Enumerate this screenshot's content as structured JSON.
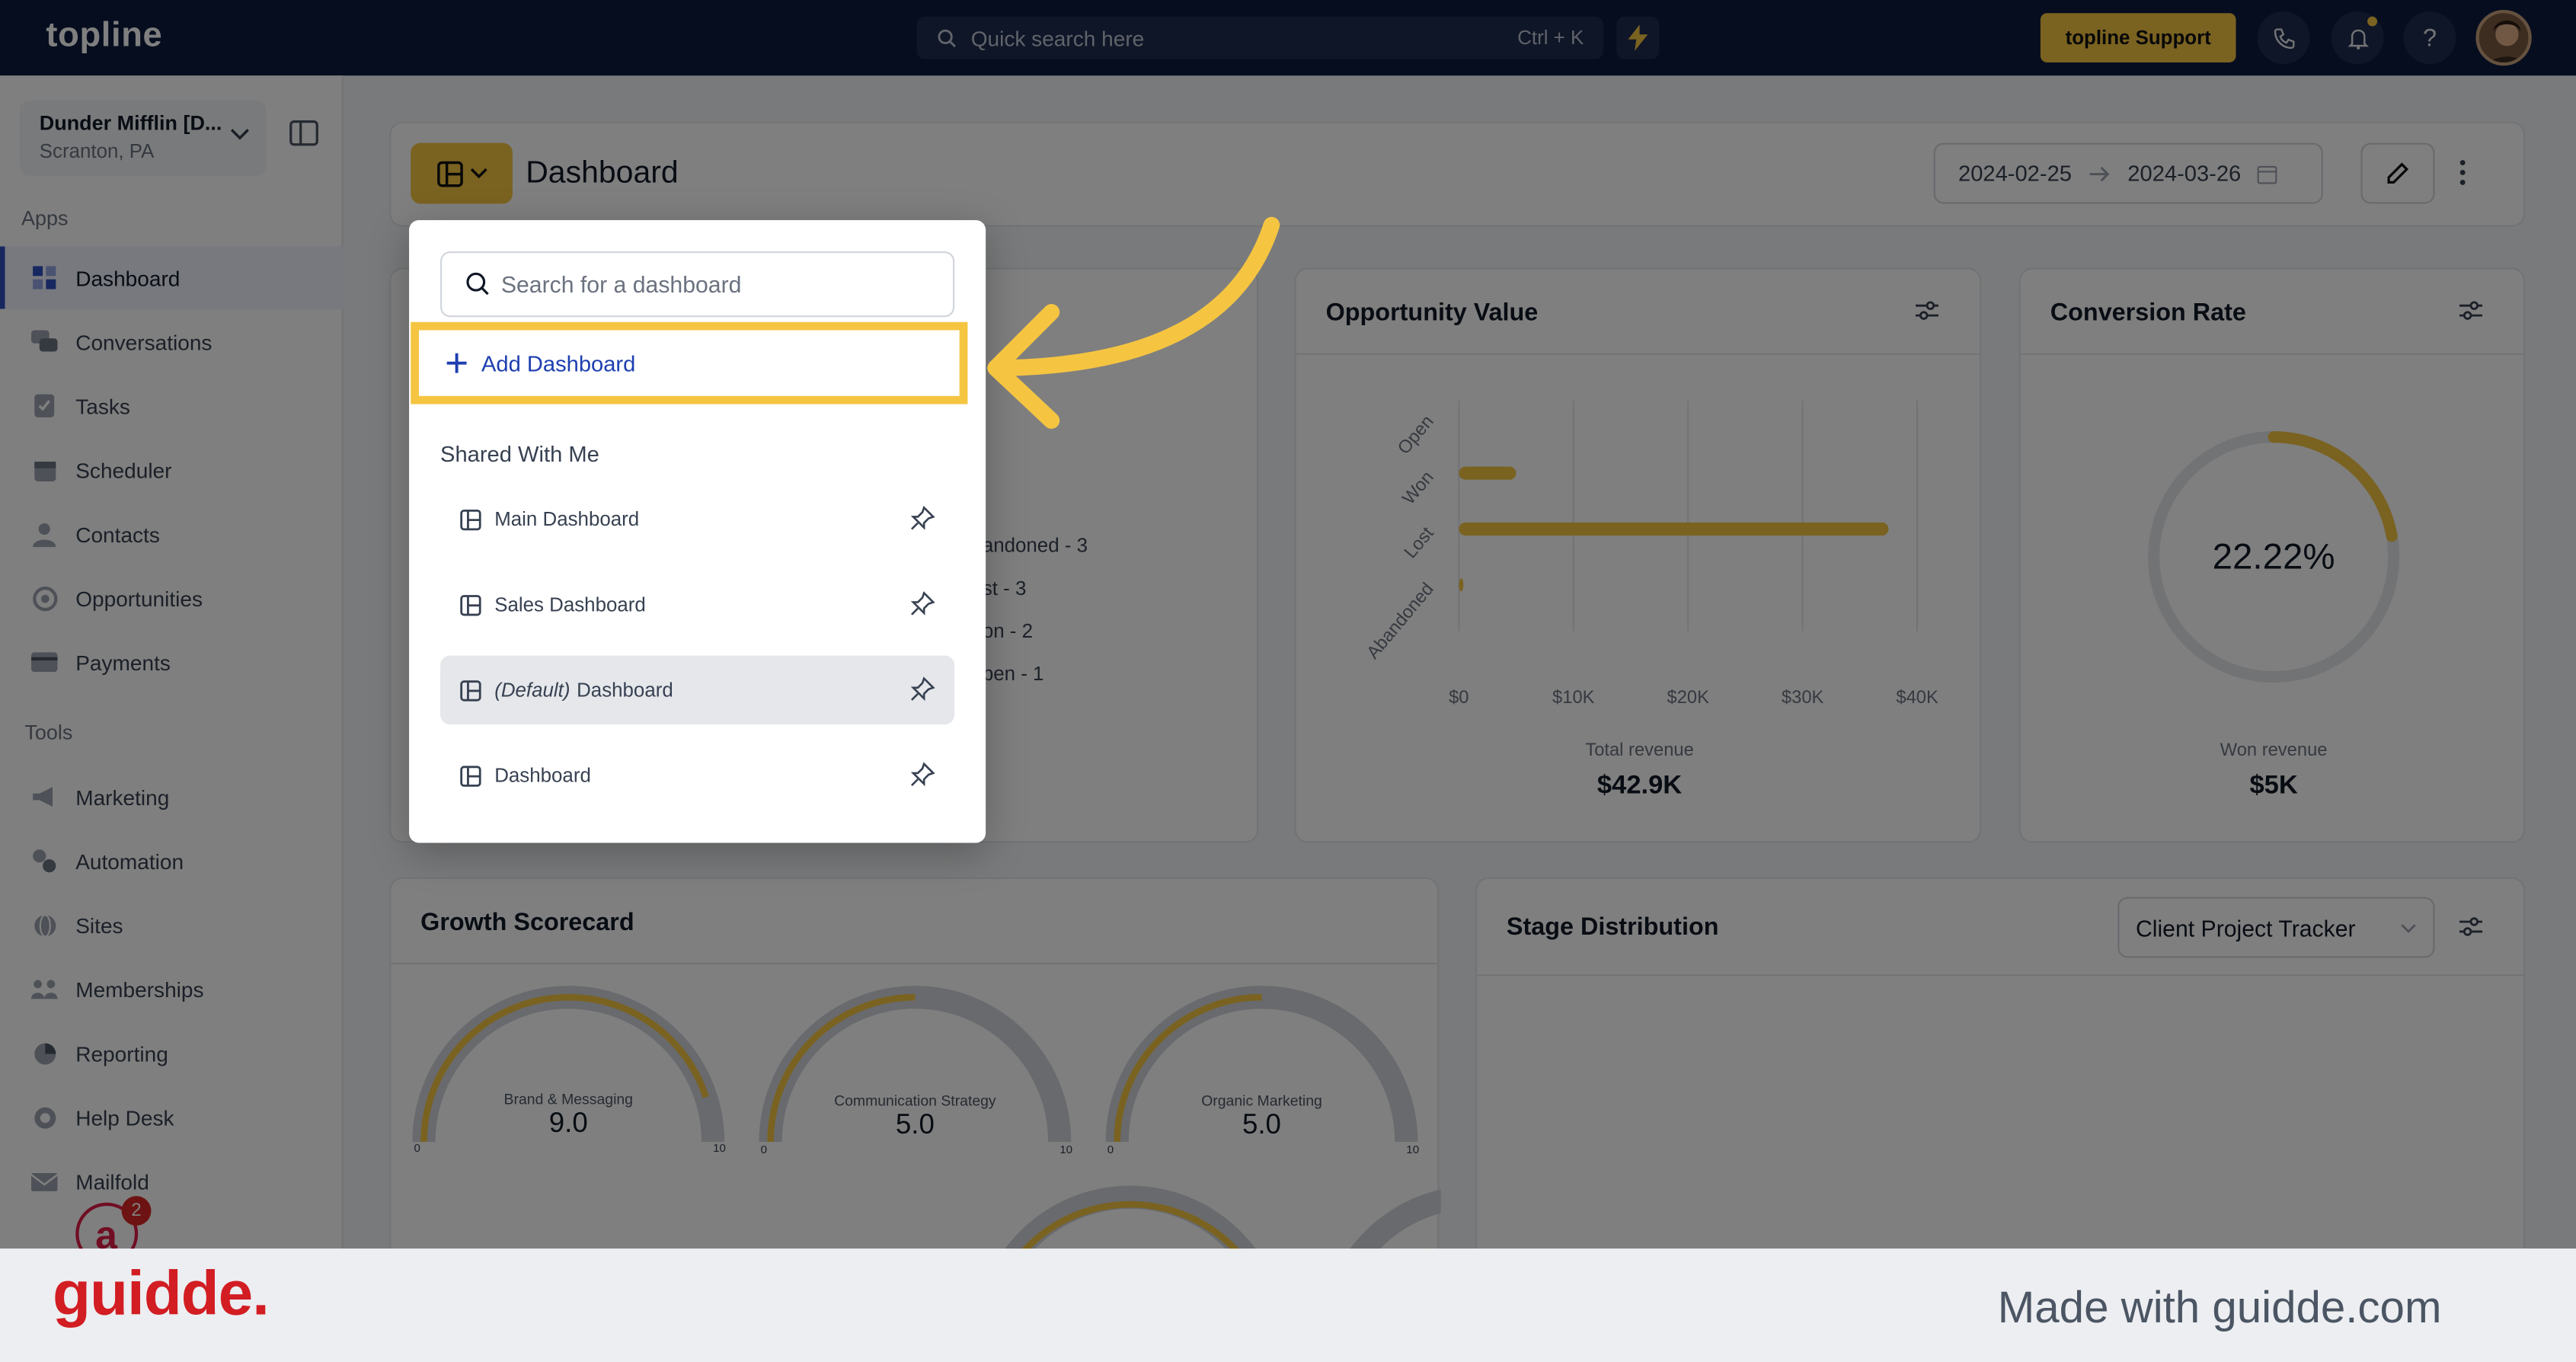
{
  "app": {
    "logo": "topline"
  },
  "topbar": {
    "search_placeholder": "Quick search here",
    "search_shortcut": "Ctrl + K",
    "support_label": "topline Support",
    "phone_icon": "phone-icon",
    "bell_icon": "bell-icon",
    "help_icon": "help-icon",
    "help_glyph": "?"
  },
  "sidebar": {
    "location": {
      "name": "Dunder Mifflin [D...",
      "address": "Scranton, PA"
    },
    "apps_label": "Apps",
    "apps": [
      {
        "label": "Dashboard",
        "icon": "dashboard-icon",
        "active": true
      },
      {
        "label": "Conversations",
        "icon": "chat-icon"
      },
      {
        "label": "Tasks",
        "icon": "tasks-icon"
      },
      {
        "label": "Scheduler",
        "icon": "calendar-icon"
      },
      {
        "label": "Contacts",
        "icon": "contacts-icon"
      },
      {
        "label": "Opportunities",
        "icon": "opportunities-icon"
      },
      {
        "label": "Payments",
        "icon": "payments-icon"
      }
    ],
    "tools_label": "Tools",
    "tools": [
      {
        "label": "Marketing",
        "icon": "megaphone-icon"
      },
      {
        "label": "Automation",
        "icon": "automation-icon"
      },
      {
        "label": "Sites",
        "icon": "globe-icon"
      },
      {
        "label": "Memberships",
        "icon": "memberships-icon"
      },
      {
        "label": "Reporting",
        "icon": "pie-chart-icon"
      },
      {
        "label": "Help Desk",
        "icon": "help-desk-icon"
      },
      {
        "label": "Mailfold",
        "icon": "mailfold-icon"
      }
    ],
    "notification_count": "2"
  },
  "header": {
    "title": "Dashboard",
    "date_start": "2024-02-25",
    "date_end": "2024-03-26"
  },
  "opportunity_value": {
    "title": "Opportunity Value",
    "total_label": "Total revenue",
    "total_value": "$42.9K",
    "chart_data": {
      "type": "bar",
      "orientation": "horizontal",
      "categories": [
        "Open",
        "Won",
        "Lost",
        "Abandoned"
      ],
      "values": [
        0,
        5000,
        37500,
        400
      ],
      "x_ticks": [
        "$0",
        "$10K",
        "$20K",
        "$30K",
        "$40K"
      ],
      "xlim": [
        0,
        40000
      ],
      "color": "#f5c542"
    }
  },
  "conversion_rate": {
    "title": "Conversion Rate",
    "value_label": "22.22%",
    "percent": 22.22,
    "caption": "Won revenue",
    "caption_value": "$5K"
  },
  "hidden_card": {
    "legend": [
      "andoned - 3",
      "st - 3",
      "on - 2",
      "pen - 1"
    ]
  },
  "growth_scorecard": {
    "title": "Growth Scorecard",
    "gauges": [
      {
        "label": "Brand & Messaging",
        "value": "9.0",
        "fraction": 0.9,
        "min": "0",
        "max": "10"
      },
      {
        "label": "Communication Strategy",
        "value": "5.0",
        "fraction": 0.5,
        "min": "0",
        "max": "10"
      },
      {
        "label": "Organic Marketing",
        "value": "5.0",
        "fraction": 0.5,
        "min": "0",
        "max": "10"
      }
    ]
  },
  "stage_distribution": {
    "title": "Stage Distribution",
    "pipeline": "Client Project Tracker"
  },
  "dropdown": {
    "search_placeholder": "Search for a dashboard",
    "add_label": "Add Dashboard",
    "section_label": "Shared With Me",
    "items": [
      {
        "label": "Main Dashboard"
      },
      {
        "label": "Sales Dashboard"
      },
      {
        "prefix": "(Default)",
        "label": "Dashboard",
        "selected": true
      },
      {
        "label": "Dashboard"
      }
    ]
  },
  "footer": {
    "brand": "guidde.",
    "made_with": "Made with guidde.com"
  },
  "colors": {
    "accent": "#f5c542",
    "nav_bg": "#0b1a3e",
    "link": "#1d3fb0",
    "brand_red": "#d21d23"
  }
}
